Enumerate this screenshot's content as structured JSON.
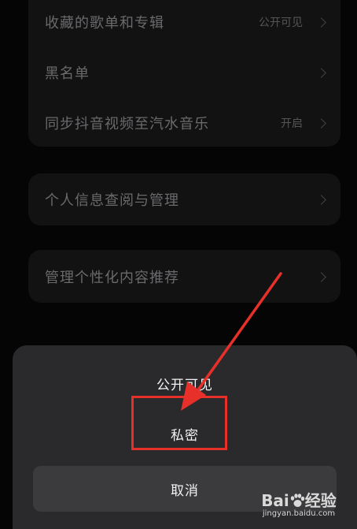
{
  "settings": {
    "group1": [
      {
        "label": "收藏的歌单和专辑",
        "value": "公开可见"
      },
      {
        "label": "黑名单",
        "value": ""
      },
      {
        "label": "同步抖音视频至汽水音乐",
        "value": "开启"
      }
    ],
    "group2": [
      {
        "label": "个人信息查阅与管理"
      }
    ],
    "group3": [
      {
        "label": "管理个性化内容推荐"
      }
    ]
  },
  "sheet": {
    "option_public": "公开可见",
    "option_private": "私密",
    "cancel": "取消"
  },
  "watermark": {
    "brand": "Bai",
    "brand_suffix": "经验",
    "url": "jingyan.baidu.com"
  },
  "colors": {
    "annotation": "#e8302a",
    "sheet_bg": "#2a2a2c",
    "cancel_bg": "#3b3b3d"
  }
}
